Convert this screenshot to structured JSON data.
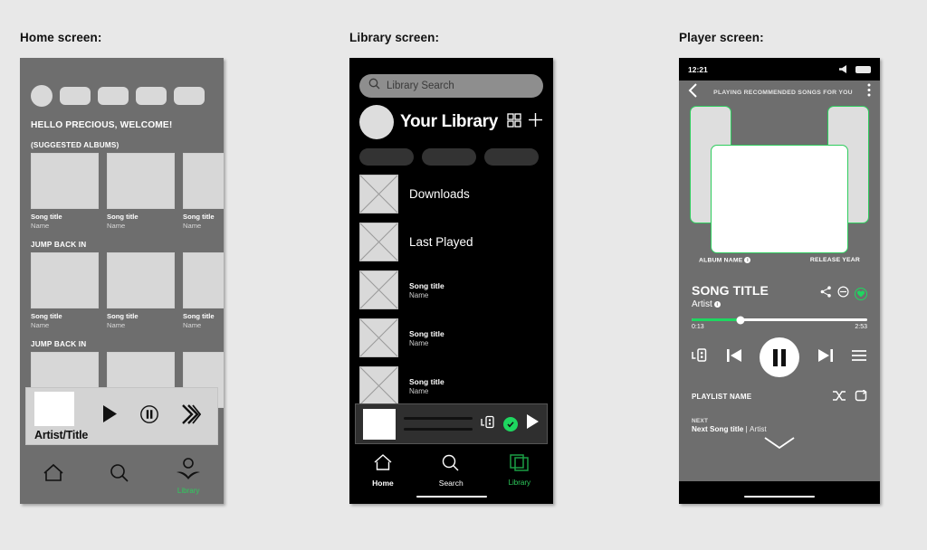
{
  "labels": {
    "home": "Home screen:",
    "library": "Library screen:",
    "player": "Player screen:"
  },
  "colors": {
    "accent_green": "#1ed760",
    "nav_green": "#2ecc5d",
    "home_bg": "#6e6e6e",
    "library_bg": "#000000",
    "placeholder_gray": "#d9d9d9"
  },
  "home": {
    "greeting": "HELLO PRECIOUS, WELCOME!",
    "sections": [
      {
        "title": "(SUGGESTED  ALBUMS)",
        "items": [
          {
            "title": "Song title",
            "name": "Name"
          },
          {
            "title": "Song title",
            "name": "Name"
          },
          {
            "title": "Song title",
            "name": "Name"
          }
        ]
      },
      {
        "title": "JUMP BACK IN",
        "items": [
          {
            "title": "Song title",
            "name": "Name"
          },
          {
            "title": "Song title",
            "name": "Name"
          },
          {
            "title": "Song title",
            "name": "Name"
          }
        ]
      },
      {
        "title": "JUMP BACK IN",
        "items": [
          {
            "title": "",
            "name": ""
          },
          {
            "title": "",
            "name": ""
          },
          {
            "title": "",
            "name": ""
          }
        ]
      }
    ],
    "mini_player": {
      "artist_title": "Artist/Title",
      "icons": [
        "play-icon",
        "pause-icon",
        "fast-forward-icon"
      ]
    },
    "nav": [
      {
        "label": "",
        "icon": "home-icon",
        "active": false
      },
      {
        "label": "",
        "icon": "search-icon",
        "active": false
      },
      {
        "label": "Library",
        "icon": "library-person-icon",
        "active": true
      }
    ]
  },
  "library": {
    "search_placeholder": "Library Search",
    "title": "Your Library",
    "header_icons": [
      "grid-view-icon",
      "plus-icon"
    ],
    "filter_chips": [
      "",
      "",
      ""
    ],
    "rows": [
      {
        "type": "big",
        "title": "Downloads"
      },
      {
        "type": "big",
        "title": "Last Played"
      },
      {
        "type": "song",
        "title": "Song title",
        "name": "Name"
      },
      {
        "type": "song",
        "title": "Song title",
        "name": "Name"
      },
      {
        "type": "song",
        "title": "Song title",
        "name": "Name"
      }
    ],
    "mini_player": {
      "icons": [
        "cast-device-icon",
        "green-check-icon",
        "play-icon"
      ]
    },
    "nav": [
      {
        "label": "Home",
        "icon": "home-icon",
        "active": false
      },
      {
        "label": "Search",
        "icon": "search-icon",
        "active": false
      },
      {
        "label": "Library",
        "icon": "library-squares-icon",
        "active": true
      }
    ]
  },
  "player": {
    "status_time": "12:21",
    "topbar_title": "PLAYING RECOMMENDED SONGS FOR YOU",
    "album_name": "ALBUM NAME",
    "release_year": "RELEASE YEAR",
    "song_title": "SONG TITLE",
    "artist": "Artist",
    "actions": [
      "share-icon",
      "block-icon",
      "heart-icon"
    ],
    "time_elapsed": "0:13",
    "time_total": "2:53",
    "progress_percent": 28,
    "controls": [
      "cast-device-icon",
      "previous-icon",
      "pause-icon",
      "next-icon",
      "queue-icon"
    ],
    "playlist_name": "PLAYLIST NAME",
    "playlist_icons": [
      "shuffle-icon",
      "repeat-icon"
    ],
    "next_label": "NEXT",
    "next_song_title": "Next Song title",
    "next_separator": "|",
    "next_artist": "Artist"
  }
}
